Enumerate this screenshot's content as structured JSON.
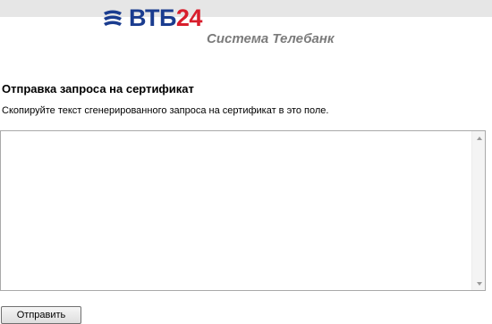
{
  "header": {
    "logo": {
      "text_main": "ВТБ",
      "text_num": "24",
      "mark_icon": "vtb-logo-mark-icon"
    },
    "tagline": "Система Телебанк"
  },
  "main": {
    "title": "Отправка запроса на сертификат",
    "instruction": "Скопируйте текст сгенерированного запроса на сертификат в это поле.",
    "request_field": {
      "value": "",
      "placeholder": ""
    },
    "submit_label": "Отправить"
  },
  "colors": {
    "brand_blue": "#1a3c8f",
    "brand_red": "#d81e2c",
    "tagline_gray": "#7b7b7b",
    "top_band": "#e6e6e6"
  }
}
